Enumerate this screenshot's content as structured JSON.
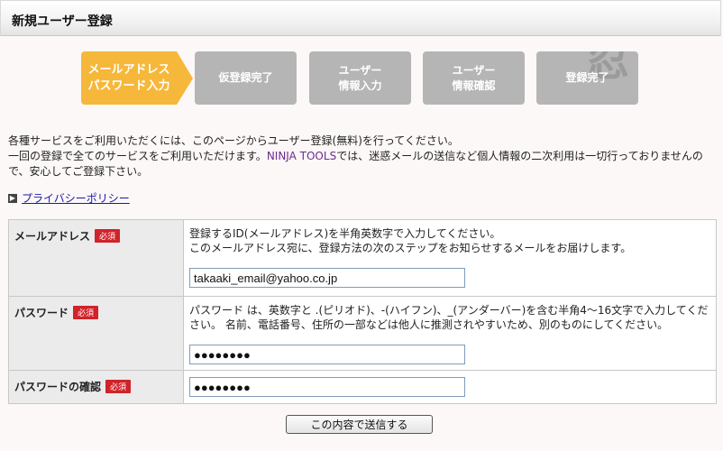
{
  "header": {
    "title": "新規ユーザー登録"
  },
  "steps": [
    {
      "label": "メールアドレス\nパスワード入力",
      "active": true
    },
    {
      "label": "仮登録完了",
      "active": false
    },
    {
      "label": "ユーザー\n情報入力",
      "active": false
    },
    {
      "label": "ユーザー\n情報確認",
      "active": false
    },
    {
      "label": "登録完了",
      "active": false,
      "watermark": "忍"
    }
  ],
  "intro": {
    "line1": "各種サービスをご利用いただくには、このページからユーザー登録(無料)を行ってください。",
    "line2_pre": "一回の登録で全てのサービスをご利用いただけます。",
    "line2_brand": "NINJA TOOLS",
    "line2_post": "では、迷惑メールの送信など個人情報の二次利用は一切行っておりませんので、安心してご登録下さい。"
  },
  "policy_link": "プライバシーポリシー",
  "required_badge": "必須",
  "fields": {
    "email": {
      "label": "メールアドレス",
      "help1": "登録するID(メールアドレス)を半角英数字で入力してください。",
      "help2": "このメールアドレス宛に、登録方法の次のステップをお知らせするメールをお届けします。",
      "value": "takaaki_email@yahoo.co.jp"
    },
    "password": {
      "label": "パスワード",
      "help": "パスワード は、英数字と .(ピリオド)、-(ハイフン)、_(アンダーバー)を含む半角4～16文字で入力してください。 名前、電話番号、住所の一部などは他人に推測されやすいため、別のものにしてください。",
      "value": "●●●●●●●●"
    },
    "password_confirm": {
      "label": "パスワードの確認",
      "value": "●●●●●●●●"
    }
  },
  "submit_label": "この内容で送信する",
  "colors": {
    "active_step": "#f6b83a",
    "inactive_step": "#b5b5b5",
    "required": "#d0232a",
    "link": "#1a1aa6",
    "brand": "#6a2c91"
  }
}
